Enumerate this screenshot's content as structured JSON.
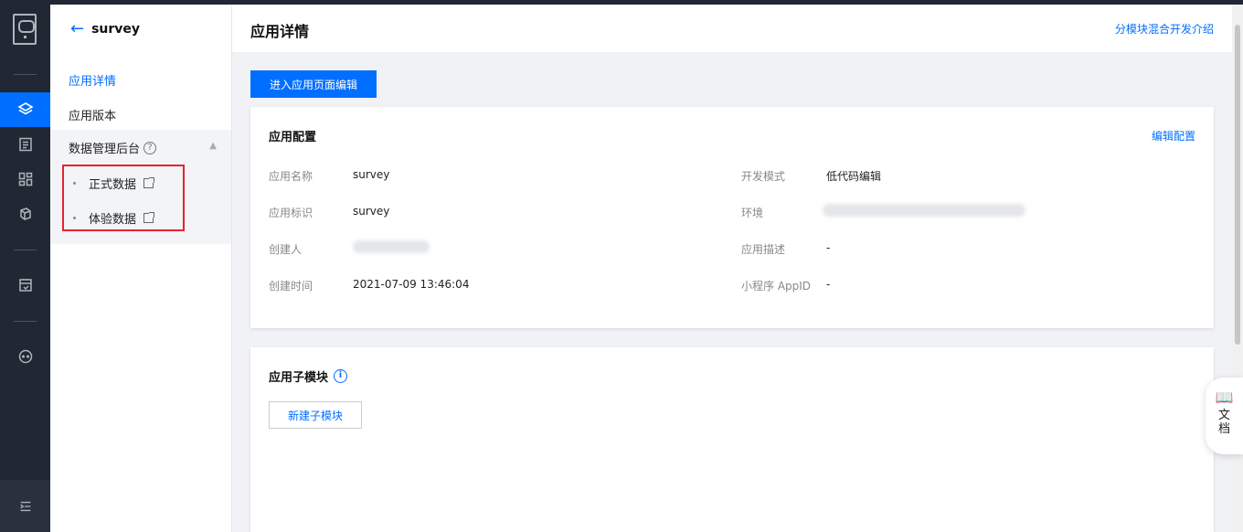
{
  "sidebar": {
    "app_name": "survey",
    "items": [
      {
        "label": "应用详情"
      },
      {
        "label": "应用版本"
      }
    ],
    "data_group": {
      "title": "数据管理后台",
      "help": "?",
      "children": [
        {
          "label": "正式数据"
        },
        {
          "label": "体验数据"
        }
      ]
    }
  },
  "header": {
    "title": "应用详情",
    "link": "分模块混合开发介绍"
  },
  "main": {
    "edit_button": "进入应用页面编辑",
    "config_card": {
      "title": "应用配置",
      "edit_link": "编辑配置",
      "fields_left": [
        {
          "label": "应用名称",
          "value": "survey"
        },
        {
          "label": "应用标识",
          "value": "survey"
        },
        {
          "label": "创建人",
          "value": ""
        },
        {
          "label": "创建时间",
          "value": "2021-07-09 13:46:04"
        }
      ],
      "fields_right": [
        {
          "label": "开发模式",
          "value": "低代码编辑"
        },
        {
          "label": "环境",
          "value": ""
        },
        {
          "label": "应用描述",
          "value": "-"
        },
        {
          "label": "小程序 AppID",
          "value": "-"
        }
      ]
    },
    "submodule_card": {
      "title": "应用子模块",
      "info": "i",
      "new_button": "新建子模块"
    }
  },
  "docs_widget": {
    "label": "文档"
  },
  "colors": {
    "accent": "#006eff",
    "rail_bg": "#202833",
    "highlight_box": "#e5232f"
  }
}
